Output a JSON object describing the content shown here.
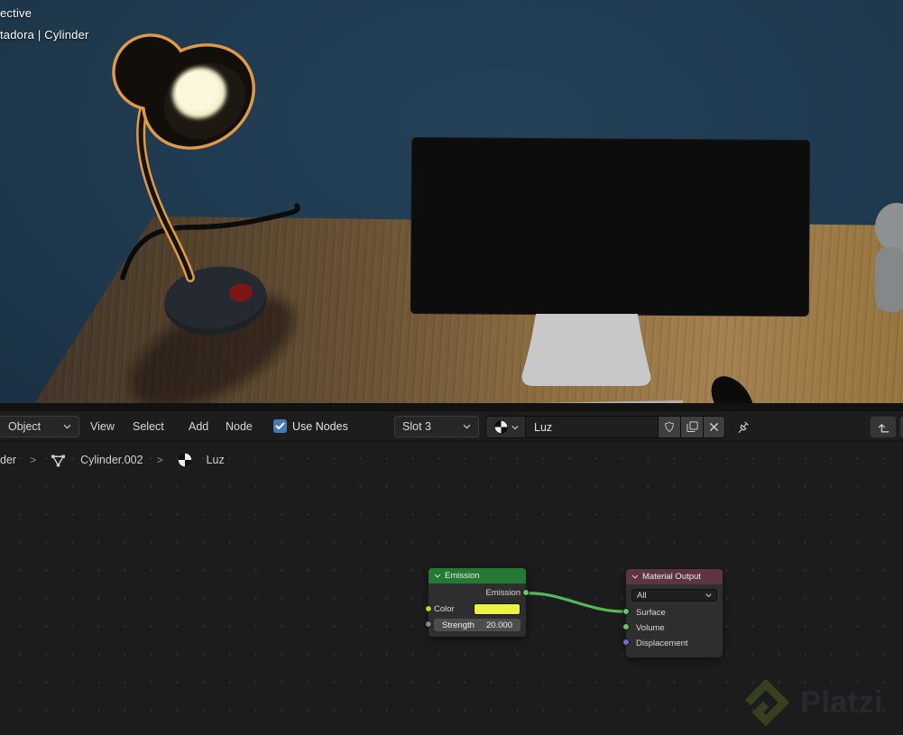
{
  "viewport": {
    "overlay_line1": "ective",
    "overlay_line2": "tadora | Cylinder"
  },
  "header": {
    "object_menu": "Object",
    "menus": [
      "View",
      "Select",
      "Add",
      "Node"
    ],
    "use_nodes_label": "Use Nodes",
    "slot": "Slot 3",
    "material_name": "Luz"
  },
  "breadcrumb": {
    "root": "der",
    "separator": ">",
    "object": "Cylinder.002",
    "material": "Luz"
  },
  "nodes": {
    "emission": {
      "title": "Emission",
      "output_label": "Emission",
      "color_label": "Color",
      "strength_label": "Strength",
      "strength_value": "20.000"
    },
    "material_output": {
      "title": "Material Output",
      "target": "All",
      "inputs": [
        "Surface",
        "Volume",
        "Displacement"
      ]
    }
  },
  "watermark": {
    "text": "Platzi"
  },
  "colors": {
    "emission_header": "#247a34",
    "output_header": "#5c3540",
    "swatch_yellow": "#e8f441",
    "wire_green": "#55b858",
    "socket_green": "#63c763",
    "socket_yellow": "#cbcb2d",
    "socket_gray": "#878787",
    "socket_vector": "#6e6ed4",
    "checkbox_blue": "#4a79b8"
  }
}
